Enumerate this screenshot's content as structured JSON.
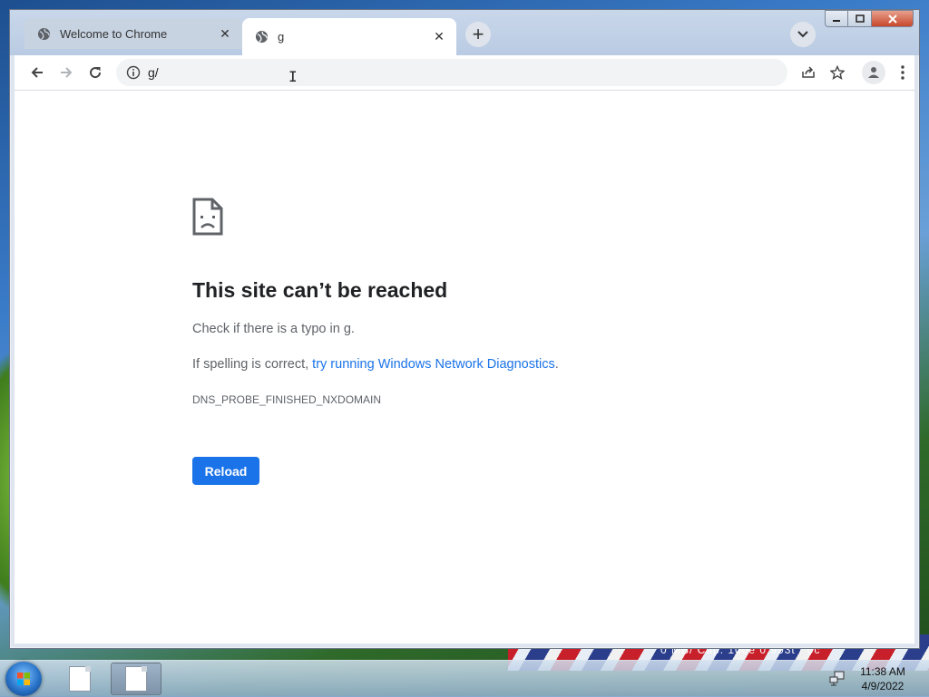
{
  "desktop": {
    "wallpaper_text": "0 MB/  Cap: 100e       0.993t            /          0c"
  },
  "browser": {
    "tabs": [
      {
        "title": "Welcome to Chrome",
        "active": false
      },
      {
        "title": "g",
        "active": true
      }
    ],
    "new_tab_label": "+",
    "address": "g/"
  },
  "error_page": {
    "heading": "This site can’t be reached",
    "line1": "Check if there is a typo in g.",
    "line2_prefix": "If spelling is correct, ",
    "line2_link": "try running Windows Network Diagnostics",
    "line2_suffix": ".",
    "error_code": "DNS_PROBE_FINISHED_NXDOMAIN",
    "reload_label": "Reload"
  },
  "taskbar": {
    "time": "11:38 AM",
    "date": "4/9/2022"
  },
  "colors": {
    "link": "#1a73e8",
    "button": "#1a73e8"
  }
}
